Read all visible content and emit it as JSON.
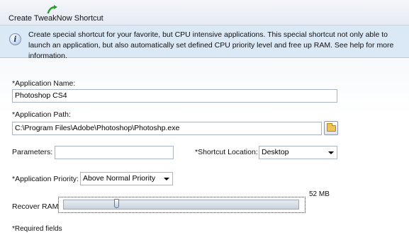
{
  "window": {
    "title": "Create TweakNow Shortcut",
    "title_icon": "green-arrow-icon"
  },
  "info": {
    "icon": "info-icon",
    "text": "Create special shortcut for your favorite, but CPU intensive applications. This special shortcut not only able to launch an application, but also automatically set defined CPU priority level and free up RAM.  See help for more information."
  },
  "form": {
    "app_name_label": "*Application Name:",
    "app_name_value": "Photoshop CS4",
    "app_path_label": "*Application Path:",
    "app_path_value": "C:\\Program Files\\Adobe\\Photoshop\\Photoshp.exe",
    "browse_icon": "folder-icon",
    "parameters_label": "Parameters:",
    "parameters_value": "",
    "shortcut_location_label": "*Shortcut Location:",
    "shortcut_location_value": "Desktop",
    "priority_label": "*Application Priority:",
    "priority_value": "Above Normal Priority",
    "recover_ram_label": "Recover RAM",
    "recover_ram_value_text": "52 MB",
    "recover_ram_fraction": 0.22,
    "required_note": "*Required fields"
  }
}
